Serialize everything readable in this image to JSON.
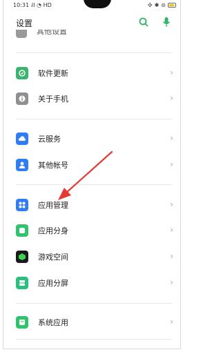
{
  "status_bar": {
    "time": "10:31",
    "network": "HD"
  },
  "header": {
    "title": "设置"
  },
  "partial_item": {
    "label": "其他设置"
  },
  "rows": [
    {
      "label": "软件更新",
      "icon": "update-icon",
      "color": "#3bb46e"
    },
    {
      "label": "关于手机",
      "icon": "info-icon",
      "color": "#8e8e93"
    },
    {
      "label": "云服务",
      "icon": "cloud-icon",
      "color": "#2f7cf6"
    },
    {
      "label": "其他帐号",
      "icon": "account-icon",
      "color": "#2f7cf6"
    },
    {
      "label": "应用管理",
      "icon": "apps-icon",
      "color": "#2f7cf6"
    },
    {
      "label": "应用分身",
      "icon": "clone-icon",
      "color": "#2fc36d"
    },
    {
      "label": "游戏空间",
      "icon": "game-icon",
      "color": "#1a1a1a"
    },
    {
      "label": "应用分屏",
      "icon": "splitscreen-icon",
      "color": "#27c07d"
    },
    {
      "label": "系统应用",
      "icon": "system-apps-icon",
      "color": "#2fc36d"
    }
  ],
  "colors": {
    "accent": "#2fb36b",
    "annotation_arrow": "#e53935"
  }
}
